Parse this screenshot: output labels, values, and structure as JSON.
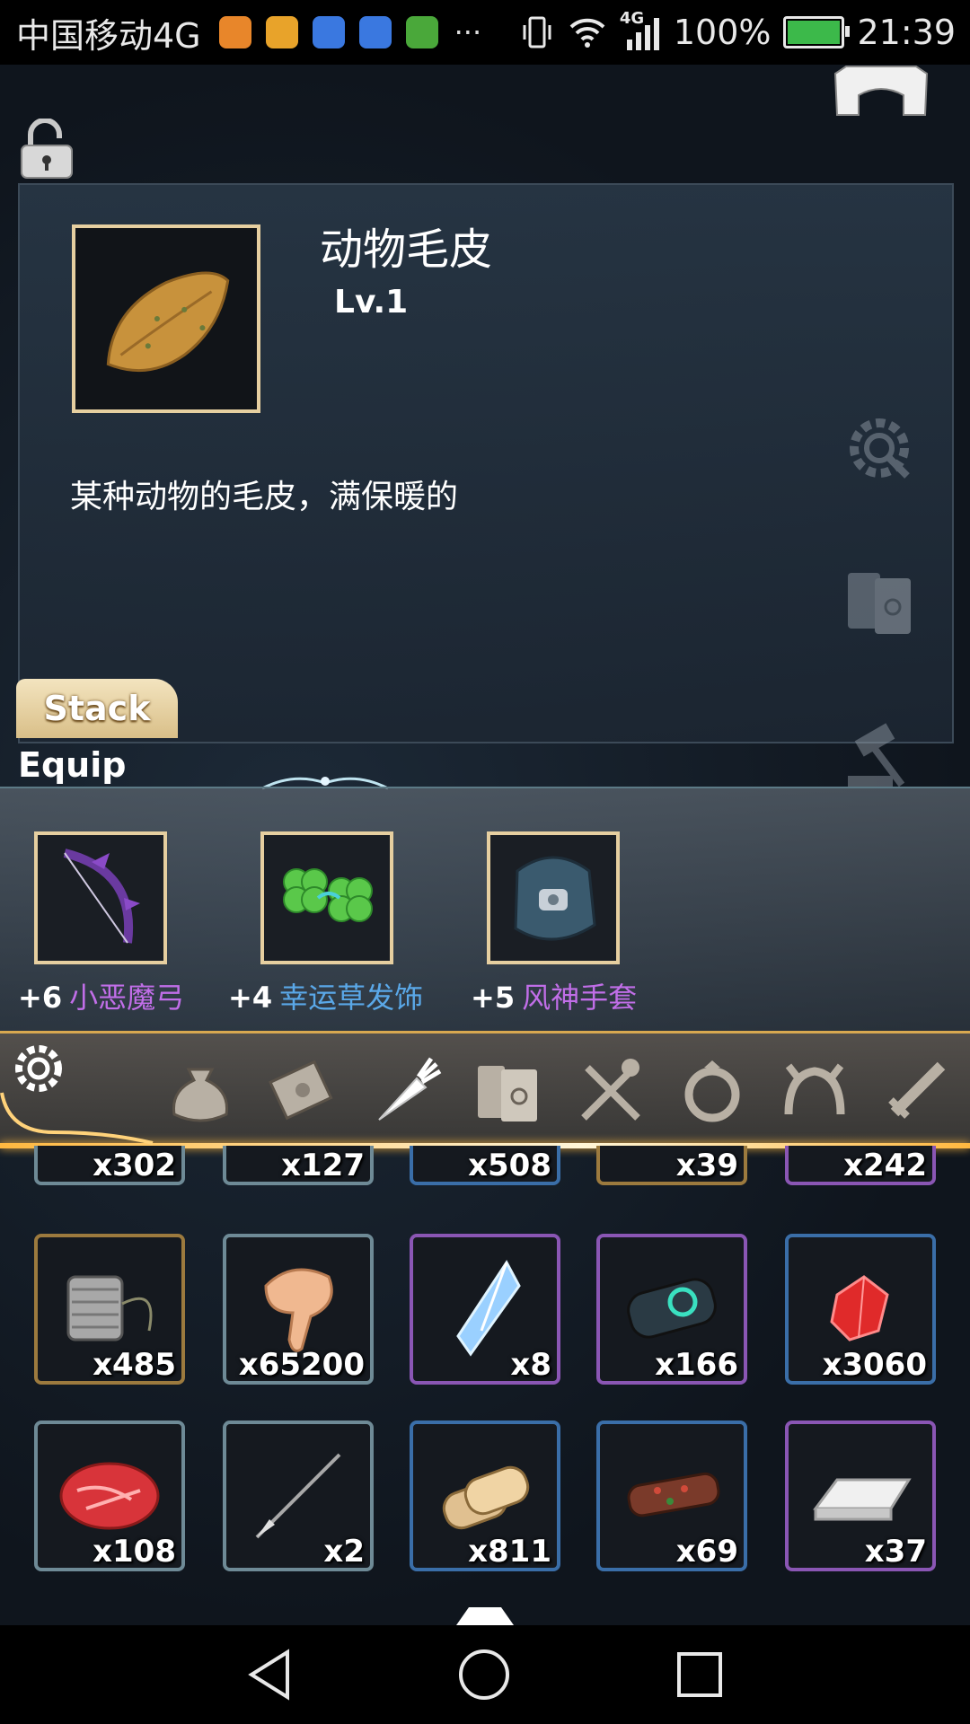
{
  "status_bar": {
    "carrier": "中国移动4G",
    "more": "···",
    "network": "4G",
    "battery": "100%",
    "battery_level": 1.0,
    "time": "21:39",
    "app_icons": [
      "health-app-icon",
      "clipboard-app-icon",
      "baidu-app-icon",
      "baidu-app-icon",
      "play-app-icon"
    ]
  },
  "item": {
    "name": "动物毛皮",
    "level": "Lv.1",
    "description": "某种动物的毛皮，满保暖的",
    "icon": "fur-icon"
  },
  "tabs": {
    "stack": "Stack",
    "equip": "Equip"
  },
  "equipment": [
    {
      "plus": "+6",
      "name": "小恶魔弓",
      "icon": "bow-icon",
      "color": "#c16ee8"
    },
    {
      "plus": "+4",
      "name": "幸运草发饰",
      "icon": "clover-icon",
      "color": "#5aa8e8"
    },
    {
      "plus": "+5",
      "name": "风神手套",
      "icon": "gloves-icon",
      "color": "#c16ee8"
    }
  ],
  "categories": [
    "all-settings-icon",
    "bag-icon",
    "scroll-icon",
    "carrot-icon",
    "books-icon",
    "cutlery-icon",
    "ring-icon",
    "headband-icon",
    "sword-icon"
  ],
  "inventory": {
    "row_partial": [
      {
        "qty": "x302"
      },
      {
        "qty": "x127"
      },
      {
        "qty": "x508"
      },
      {
        "qty": "x39"
      },
      {
        "qty": "x242"
      }
    ],
    "row_1": [
      {
        "qty": "x485",
        "icon": "thread-spool-icon"
      },
      {
        "qty": "x65200",
        "icon": "meat-leg-icon"
      },
      {
        "qty": "x8",
        "icon": "crystal-icon"
      },
      {
        "qty": "x166",
        "icon": "scroll-bundle-icon"
      },
      {
        "qty": "x3060",
        "icon": "red-gem-icon"
      }
    ],
    "row_2": [
      {
        "qty": "x108",
        "icon": "steak-icon"
      },
      {
        "qty": "x2",
        "icon": "spear-icon"
      },
      {
        "qty": "x811",
        "icon": "logs-icon"
      },
      {
        "qty": "x69",
        "icon": "branch-icon"
      },
      {
        "qty": "x37",
        "icon": "silver-ingot-icon"
      }
    ]
  }
}
